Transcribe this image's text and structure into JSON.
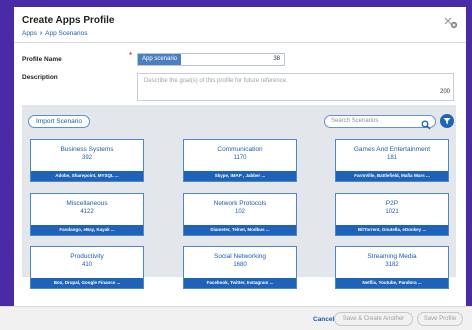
{
  "dialog": {
    "title": "Create Apps Profile",
    "close_icon": "close-icon"
  },
  "breadcrumb": {
    "root": "Apps",
    "current": "App Scenarios"
  },
  "form": {
    "profile_name_label": "Profile Name",
    "profile_name_value": "App scenario",
    "profile_name_remaining": "38",
    "description_label": "Description",
    "description_placeholder": "Describe the goal(s) of this profile for future reference.",
    "description_remaining": "200",
    "required_marker": "*"
  },
  "panel": {
    "import_label": "Import Scenario",
    "search_placeholder": "Search Scenarios",
    "search_icon": "search-icon",
    "filter_icon": "filter-icon",
    "accent_color": "#1f63b8"
  },
  "scenarios": [
    {
      "name": "Business Systems",
      "count": "392",
      "apps": "Adobe, Sharepoint, MYSQL ..."
    },
    {
      "name": "Communication",
      "count": "1170",
      "apps": "Skype, IMAP , Jabber ..."
    },
    {
      "name": "Games And Entertainment",
      "count": "181",
      "apps": "FarmVille, Battlefield, Mafia Wars ..."
    },
    {
      "name": "Miscellaneous",
      "count": "4122",
      "apps": "Fandango, eBay, Kayak ..."
    },
    {
      "name": "Network Protocols",
      "count": "102",
      "apps": "Diameter, Telnet, Modbus ..."
    },
    {
      "name": "P2P",
      "count": "1021",
      "apps": "BitTorrent, Gnutella, eDonkey ..."
    },
    {
      "name": "Productivity",
      "count": "410",
      "apps": "Box, Drupal, Google Finance ..."
    },
    {
      "name": "Social Networking",
      "count": "1680",
      "apps": "Facebook, Twitter, Instagram ..."
    },
    {
      "name": "Streaming Media",
      "count": "3182",
      "apps": "Netflix, Youtube, Pandora ..."
    }
  ],
  "footer": {
    "cancel_label": "Cancel",
    "save_create_label": "Save & Create Another",
    "save_label": "Save Profile"
  }
}
